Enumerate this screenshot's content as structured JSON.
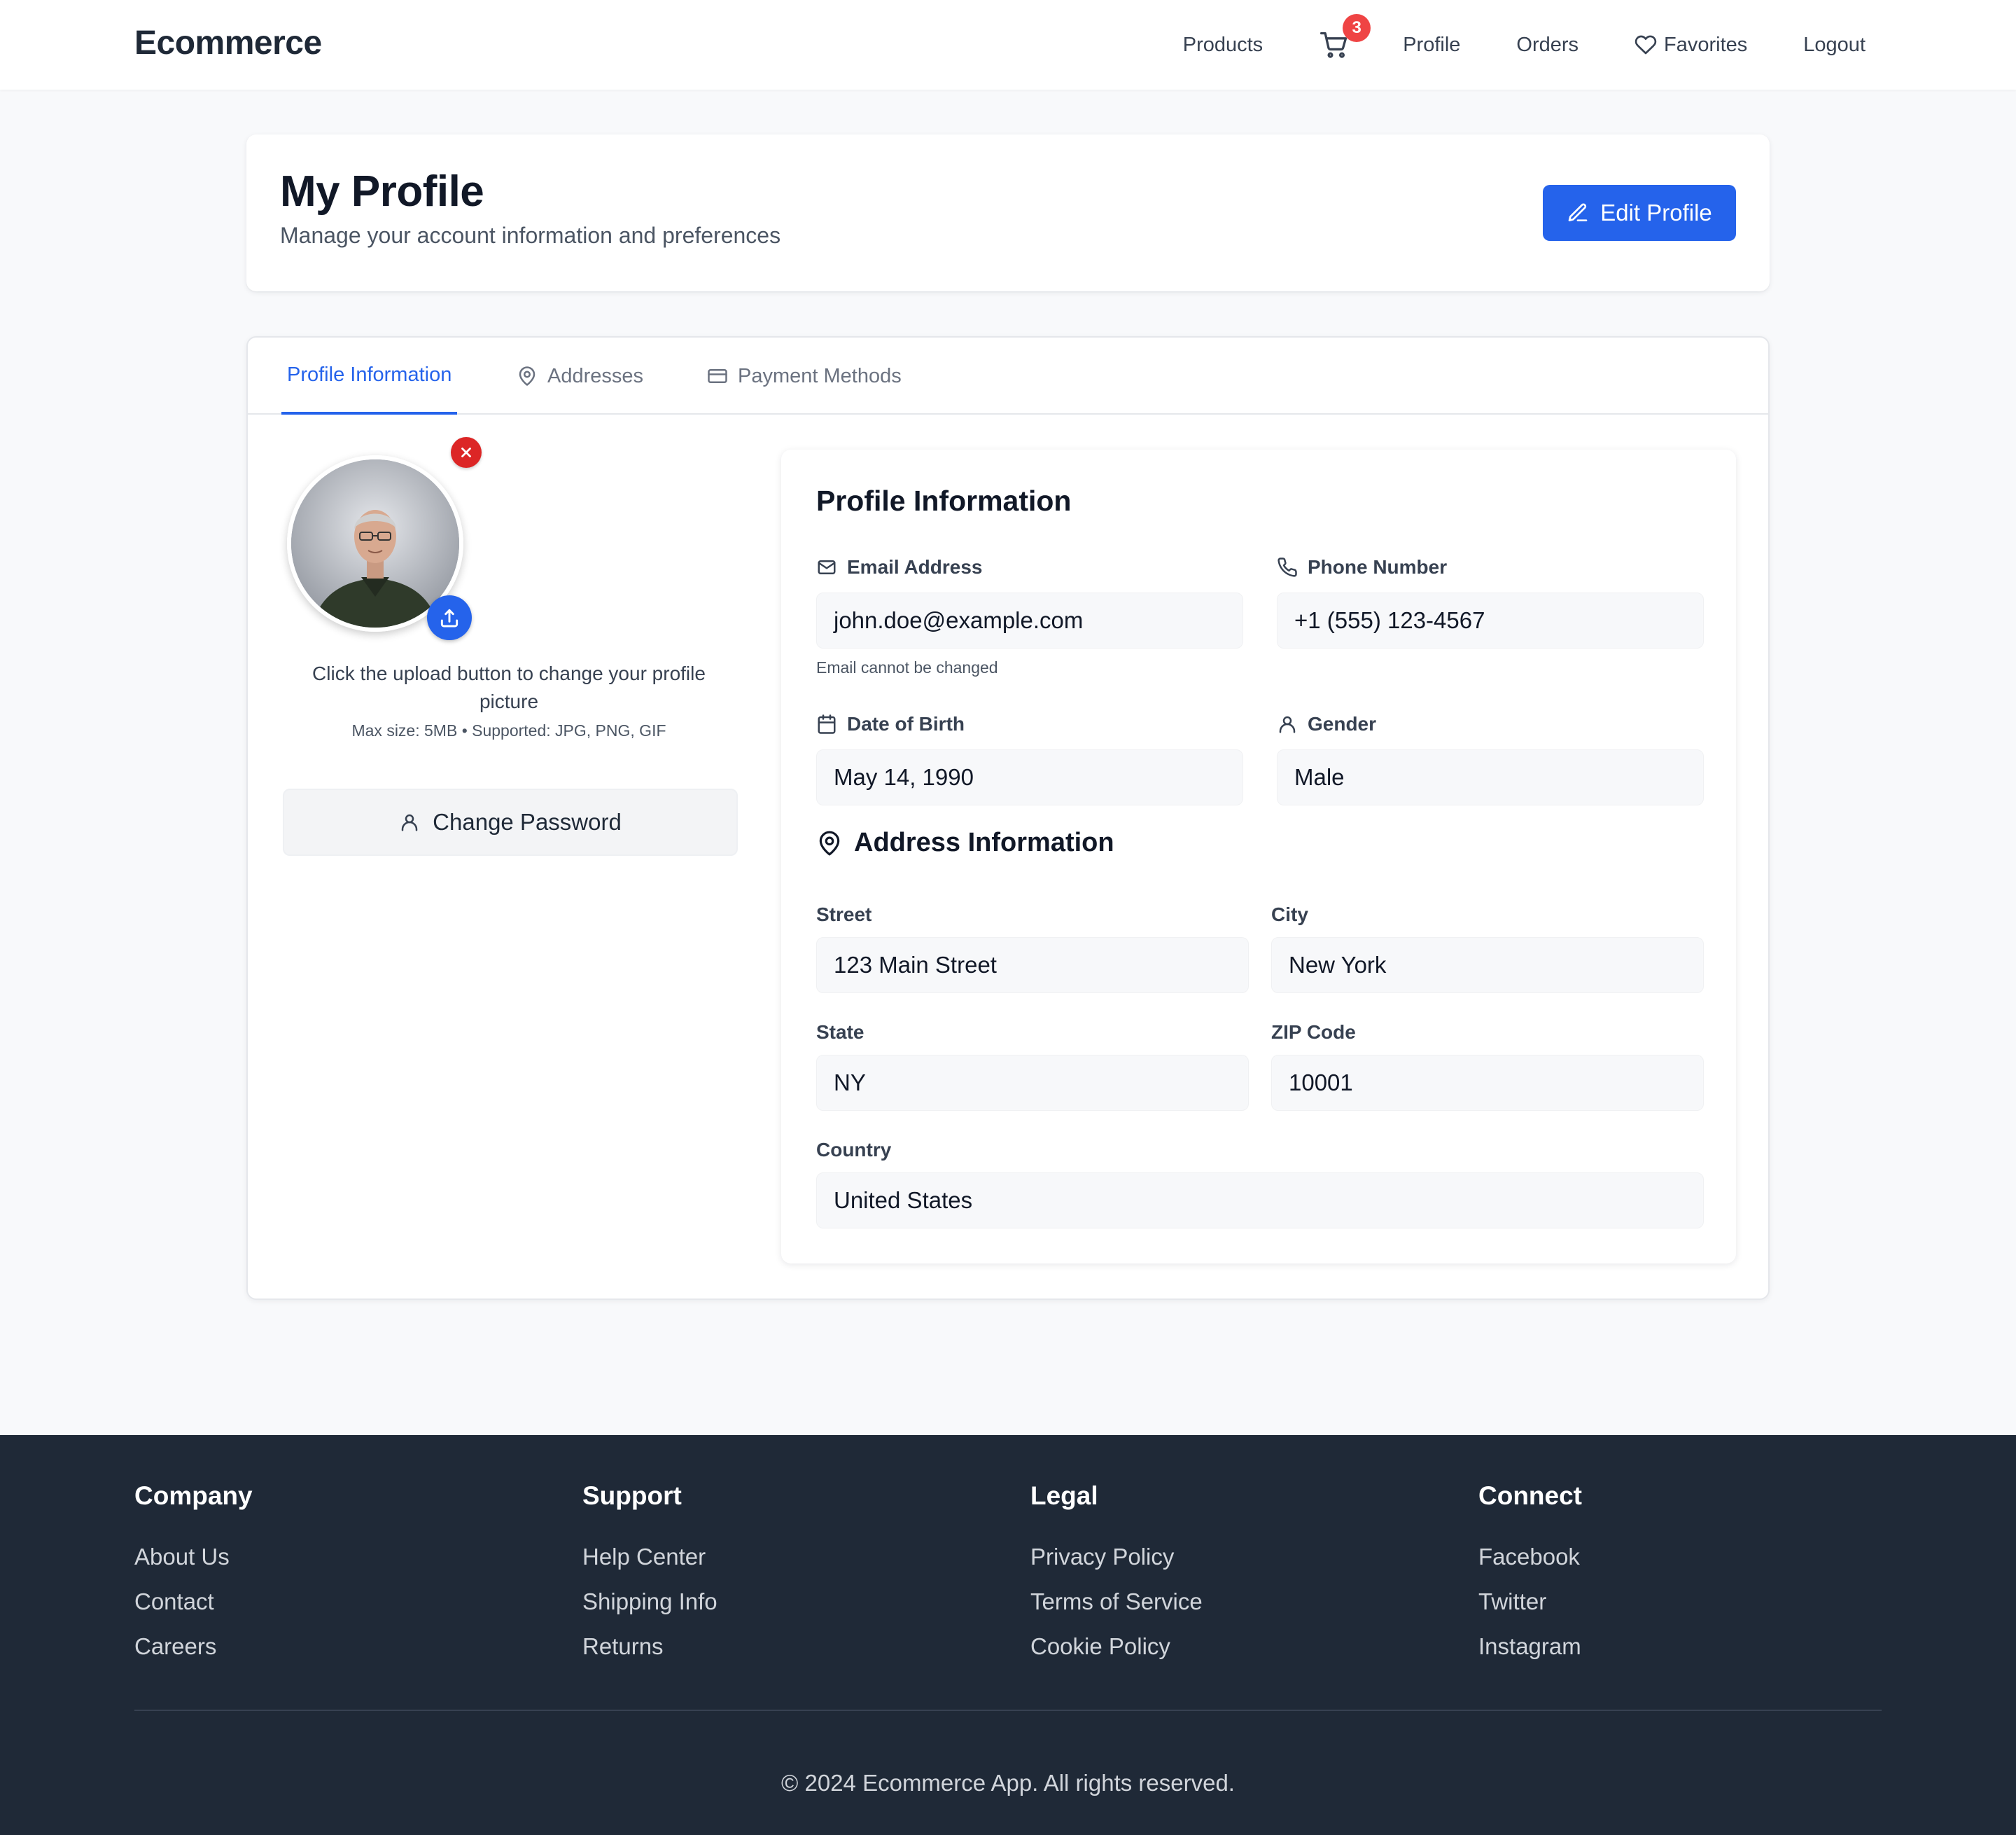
{
  "nav": {
    "brand": "Ecommerce",
    "products": "Products",
    "cart_count": "3",
    "profile": "Profile",
    "orders": "Orders",
    "favorites": "Favorites",
    "logout": "Logout"
  },
  "header": {
    "title": "My Profile",
    "subtitle": "Manage your account information and preferences",
    "edit_button": "Edit Profile"
  },
  "tabs": [
    {
      "label": "Profile Information",
      "icon": "none",
      "active": true
    },
    {
      "label": "Addresses",
      "icon": "map-pin-icon"
    },
    {
      "label": "Payment Methods",
      "icon": "credit-card-icon"
    }
  ],
  "avatar": {
    "upload_hint": "Click the upload button to change your profile picture",
    "upload_meta": "Max size: 5MB • Supported: JPG, PNG, GIF",
    "change_password": "Change Password"
  },
  "profile": {
    "title": "Profile Information",
    "email_label": "Email Address",
    "email_value": "john.doe@example.com",
    "email_note": "Email cannot be changed",
    "phone_label": "Phone Number",
    "phone_value": "+1 (555) 123-4567",
    "dob_label": "Date of Birth",
    "dob_value": "May 14, 1990",
    "gender_label": "Gender",
    "gender_value": "Male"
  },
  "address": {
    "title": "Address Information",
    "street_label": "Street",
    "street_value": "123 Main Street",
    "city_label": "City",
    "city_value": "New York",
    "state_label": "State",
    "state_value": "NY",
    "zip_label": "ZIP Code",
    "zip_value": "10001",
    "country_label": "Country",
    "country_value": "United States"
  },
  "footer": {
    "columns": [
      {
        "heading": "Company",
        "links": [
          "About Us",
          "Contact",
          "Careers"
        ]
      },
      {
        "heading": "Support",
        "links": [
          "Help Center",
          "Shipping Info",
          "Returns"
        ]
      },
      {
        "heading": "Legal",
        "links": [
          "Privacy Policy",
          "Terms of Service",
          "Cookie Policy"
        ]
      },
      {
        "heading": "Connect",
        "links": [
          "Facebook",
          "Twitter",
          "Instagram"
        ]
      }
    ],
    "copyright": "© 2024 Ecommerce App. All rights reserved."
  },
  "colors": {
    "accent": "#2563eb",
    "danger": "#ef4444",
    "footer_bg": "#1f2937",
    "page_bg": "#f8f9fb"
  }
}
